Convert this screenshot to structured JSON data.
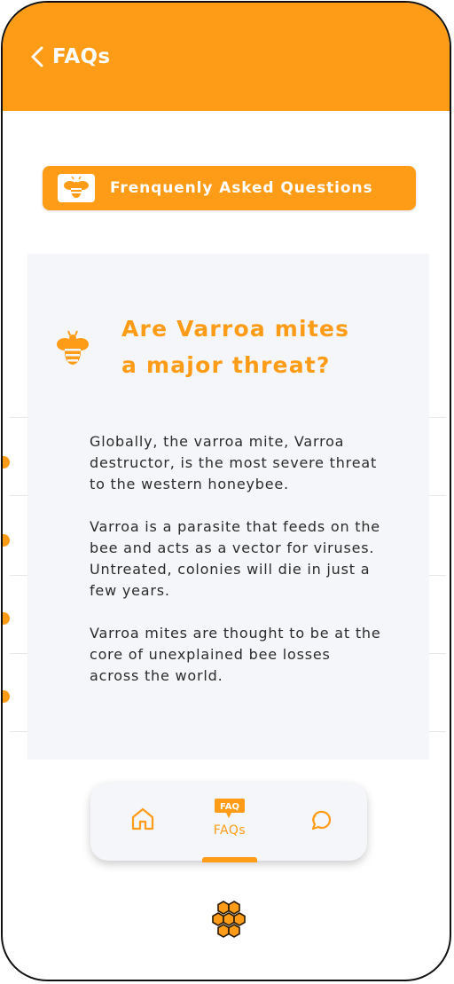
{
  "header": {
    "title": "FAQs"
  },
  "banner": {
    "label": "Frenquenly Asked Questions"
  },
  "modal": {
    "title_line1": "Are Varroa mites",
    "title_line2": "a major threat?",
    "paragraphs": [
      "Globally, the varroa mite, Varroa destructor, is the most severe threat to the western honeybee.",
      "Varroa is a parasite that feeds on the bee and acts as a vector for viruses. Untreated, colonies will die in just a few years.",
      "Varroa mites are thought to be at the core of unexplained bee losses across the world."
    ]
  },
  "nav": {
    "faq_label": "FAQs",
    "faq_badge": "FAQ"
  },
  "colors": {
    "accent": "#FF9C17",
    "modal_bg": "#F5F6F9",
    "text": "#2b2b2b"
  },
  "icons": {
    "back": "chevron-left-icon",
    "bee": "bee-icon",
    "home": "home-icon",
    "faq": "faq-bubble-icon",
    "chat": "chat-icon",
    "logo": "honeycomb-icon"
  }
}
